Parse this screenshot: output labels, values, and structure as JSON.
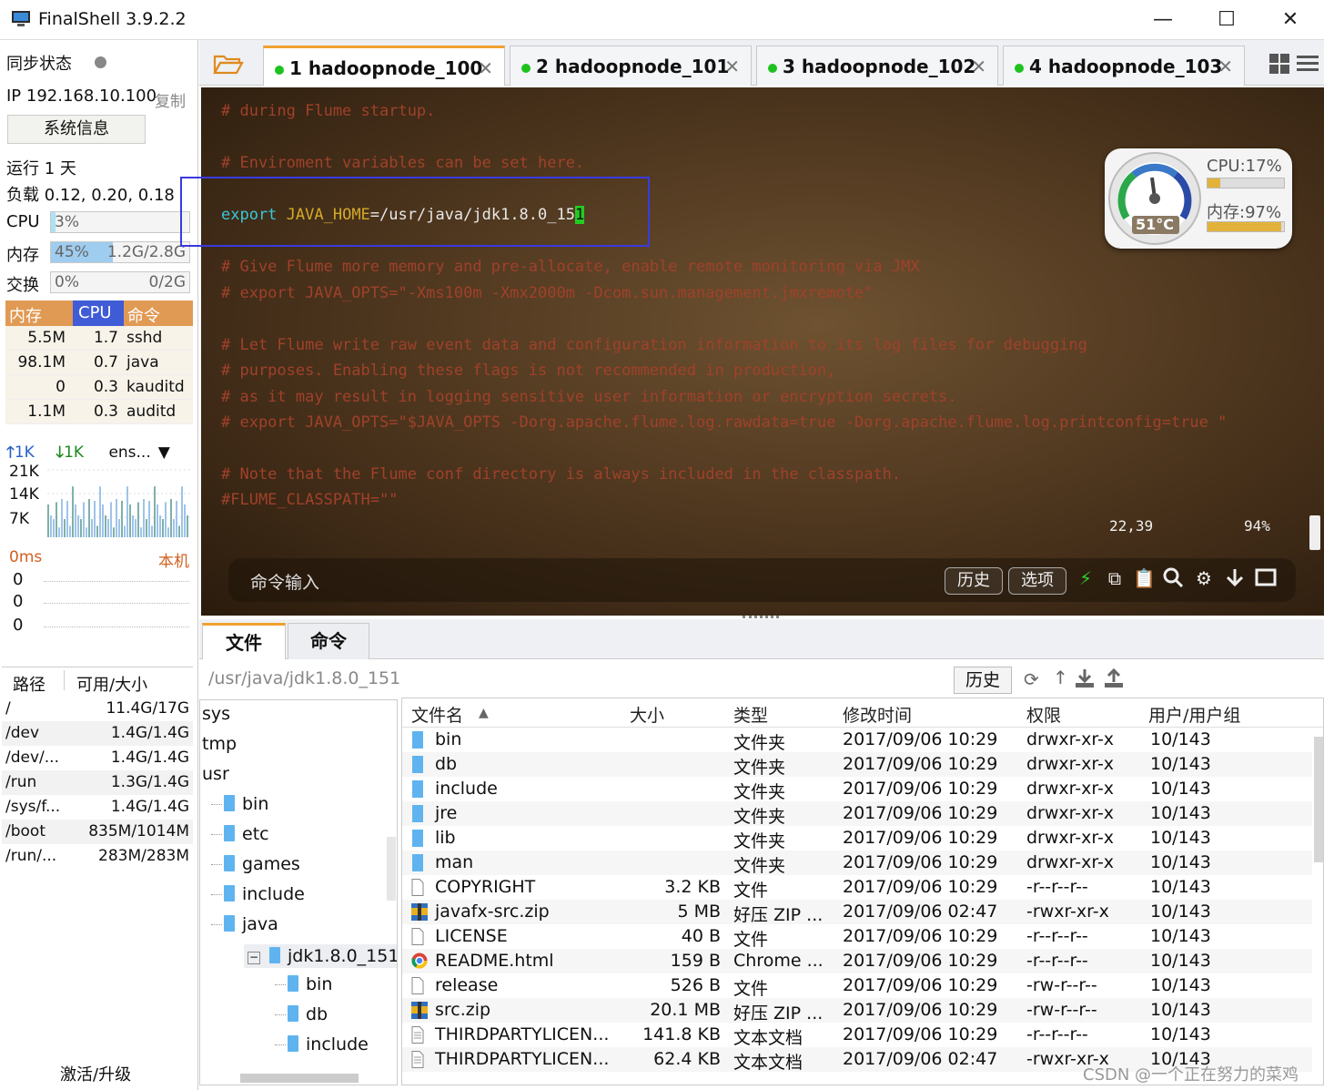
{
  "window": {
    "title": "FinalShell 3.9.2.2",
    "minimize": "—",
    "maximize": "☐",
    "close": "✕"
  },
  "sidebar": {
    "sync_label": "同步状态",
    "ip_label": "IP 192.168.10.100",
    "copy_label": "复制",
    "sysinfo_button": "系统信息",
    "uptime": "运行 1 天",
    "load": "负载 0.12, 0.20, 0.18",
    "cpu": {
      "label": "CPU",
      "value": "3%",
      "fraction": 0.03
    },
    "mem": {
      "label": "内存",
      "value": "45%",
      "detail": "1.2G/2.8G",
      "fraction": 0.45
    },
    "swap": {
      "label": "交换",
      "value": "0%",
      "detail": "0/2G",
      "fraction": 0
    },
    "proc_headers": [
      "内存",
      "CPU",
      "命令"
    ],
    "processes": [
      {
        "mem": "5.5M",
        "cpu": "1.7",
        "cmd": "sshd"
      },
      {
        "mem": "98.1M",
        "cpu": "0.7",
        "cmd": "java"
      },
      {
        "mem": "0",
        "cpu": "0.3",
        "cmd": "kauditd"
      },
      {
        "mem": "1.1M",
        "cpu": "0.3",
        "cmd": "auditd"
      }
    ],
    "net": {
      "up": "1K",
      "down": "1K",
      "iface": "ens...",
      "ticks": [
        "21K",
        "14K",
        "7K"
      ]
    },
    "ping": {
      "label": "0ms",
      "host": "本机",
      "values": [
        "0",
        "0",
        "0"
      ]
    },
    "disk_headers": [
      "路径",
      "可用/大小"
    ],
    "disks": [
      {
        "path": "/",
        "size": "11.4G/17G"
      },
      {
        "path": "/dev",
        "size": "1.4G/1.4G"
      },
      {
        "path": "/dev/...",
        "size": "1.4G/1.4G"
      },
      {
        "path": "/run",
        "size": "1.3G/1.4G"
      },
      {
        "path": "/sys/f...",
        "size": "1.4G/1.4G"
      },
      {
        "path": "/boot",
        "size": "835M/1014M"
      },
      {
        "path": "/run/...",
        "size": "283M/283M"
      }
    ],
    "activate": "激活/升级"
  },
  "tabs": [
    {
      "label": "1 hadoopnode_100",
      "active": true
    },
    {
      "label": "2 hadoopnode_101",
      "active": false
    },
    {
      "label": "3 hadoopnode_102",
      "active": false
    },
    {
      "label": "4 hadoopnode_103",
      "active": false
    }
  ],
  "terminal": {
    "lines": [
      {
        "text": "# during Flume startup.",
        "type": "comment"
      },
      {
        "text": "# Enviroment variables can be set here.",
        "type": "comment"
      },
      {
        "kw": "export",
        "var": "JAVA_HOME",
        "rest": "=/usr/java/jdk1.8.0_15",
        "cursor": "1",
        "type": "export"
      },
      {
        "text": "# Give Flume more memory and pre-allocate, enable remote monitoring via JMX",
        "type": "comment"
      },
      {
        "text": "# export JAVA_OPTS=\"-Xms100m -Xmx2000m -Dcom.sun.management.jmxremote\"",
        "type": "comment"
      },
      {
        "text": "# Let Flume write raw event data and configuration information to its log files for debugging",
        "type": "comment"
      },
      {
        "text": "# purposes. Enabling these flags is not recommended in production,",
        "type": "comment"
      },
      {
        "text": "# as it may result in logging sensitive user information or encryption secrets.",
        "type": "comment"
      },
      {
        "text": "# export JAVA_OPTS=\"$JAVA_OPTS -Dorg.apache.flume.log.rawdata=true -Dorg.apache.flume.log.printconfig=true \"",
        "type": "comment"
      },
      {
        "text": "# Note that the Flume conf directory is always included in the classpath.",
        "type": "comment"
      },
      {
        "text": "#FLUME_CLASSPATH=\"\"",
        "type": "comment"
      }
    ],
    "position": "22,39",
    "percent": "94%",
    "cmd_placeholder": "命令输入",
    "history_button": "历史",
    "options_button": "选项"
  },
  "gauge": {
    "cpu": "CPU:17%",
    "mem": "内存:97%",
    "temp": "51°C",
    "cpu_fraction": 0.17,
    "mem_fraction": 0.97
  },
  "bottom_tabs": [
    "文件",
    "命令"
  ],
  "file_path": "/usr/java/jdk1.8.0_151",
  "file_history_button": "历史",
  "tree": [
    {
      "label": "sys",
      "level": 0,
      "folder": false
    },
    {
      "label": "tmp",
      "level": 0,
      "folder": false
    },
    {
      "label": "usr",
      "level": 0,
      "folder": false
    },
    {
      "label": "bin",
      "level": 1,
      "folder": true
    },
    {
      "label": "etc",
      "level": 1,
      "folder": true
    },
    {
      "label": "games",
      "level": 1,
      "folder": true
    },
    {
      "label": "include",
      "level": 1,
      "folder": true
    },
    {
      "label": "java",
      "level": 1,
      "folder": true
    },
    {
      "label": "jdk1.8.0_151",
      "level": 2,
      "folder": true,
      "selected": true
    },
    {
      "label": "bin",
      "level": 3,
      "folder": true
    },
    {
      "label": "db",
      "level": 3,
      "folder": true
    },
    {
      "label": "include",
      "level": 3,
      "folder": true
    }
  ],
  "file_headers": [
    "文件名",
    "大小",
    "类型",
    "修改时间",
    "权限",
    "用户/用户组"
  ],
  "files": [
    {
      "name": "bin",
      "size": "",
      "type": "文件夹",
      "mtime": "2017/09/06 10:29",
      "perm": "drwxr-xr-x",
      "owner": "10/143",
      "icon": "folder"
    },
    {
      "name": "db",
      "size": "",
      "type": "文件夹",
      "mtime": "2017/09/06 10:29",
      "perm": "drwxr-xr-x",
      "owner": "10/143",
      "icon": "folder"
    },
    {
      "name": "include",
      "size": "",
      "type": "文件夹",
      "mtime": "2017/09/06 10:29",
      "perm": "drwxr-xr-x",
      "owner": "10/143",
      "icon": "folder"
    },
    {
      "name": "jre",
      "size": "",
      "type": "文件夹",
      "mtime": "2017/09/06 10:29",
      "perm": "drwxr-xr-x",
      "owner": "10/143",
      "icon": "folder"
    },
    {
      "name": "lib",
      "size": "",
      "type": "文件夹",
      "mtime": "2017/09/06 10:29",
      "perm": "drwxr-xr-x",
      "owner": "10/143",
      "icon": "folder"
    },
    {
      "name": "man",
      "size": "",
      "type": "文件夹",
      "mtime": "2017/09/06 10:29",
      "perm": "drwxr-xr-x",
      "owner": "10/143",
      "icon": "folder"
    },
    {
      "name": "COPYRIGHT",
      "size": "3.2 KB",
      "type": "文件",
      "mtime": "2017/09/06 10:29",
      "perm": "-r--r--r--",
      "owner": "10/143",
      "icon": "file"
    },
    {
      "name": "javafx-src.zip",
      "size": "5 MB",
      "type": "好压 ZIP ...",
      "mtime": "2017/09/06 02:47",
      "perm": "-rwxr-xr-x",
      "owner": "10/143",
      "icon": "zip"
    },
    {
      "name": "LICENSE",
      "size": "40 B",
      "type": "文件",
      "mtime": "2017/09/06 10:29",
      "perm": "-r--r--r--",
      "owner": "10/143",
      "icon": "file"
    },
    {
      "name": "README.html",
      "size": "159 B",
      "type": "Chrome ...",
      "mtime": "2017/09/06 10:29",
      "perm": "-r--r--r--",
      "owner": "10/143",
      "icon": "chrome"
    },
    {
      "name": "release",
      "size": "526 B",
      "type": "文件",
      "mtime": "2017/09/06 10:29",
      "perm": "-rw-r--r--",
      "owner": "10/143",
      "icon": "file"
    },
    {
      "name": "src.zip",
      "size": "20.1 MB",
      "type": "好压 ZIP ...",
      "mtime": "2017/09/06 10:29",
      "perm": "-rw-r--r--",
      "owner": "10/143",
      "icon": "zip"
    },
    {
      "name": "THIRDPARTYLICEN...",
      "size": "141.8 KB",
      "type": "文本文档",
      "mtime": "2017/09/06 10:29",
      "perm": "-r--r--r--",
      "owner": "10/143",
      "icon": "text"
    },
    {
      "name": "THIRDPARTYLICEN...",
      "size": "62.4 KB",
      "type": "文本文档",
      "mtime": "2017/09/06 02:47",
      "perm": "-rwxr-xr-x",
      "owner": "10/143",
      "icon": "text"
    }
  ],
  "watermark": "CSDN @一个正在努力的菜鸡",
  "colors": {
    "accent": "#f0a030",
    "proc_header": "#e19a54",
    "folder": "#5fb4ef",
    "comment": "#a0412a",
    "keyword": "#38c8d8",
    "variable": "#d4aa28"
  }
}
